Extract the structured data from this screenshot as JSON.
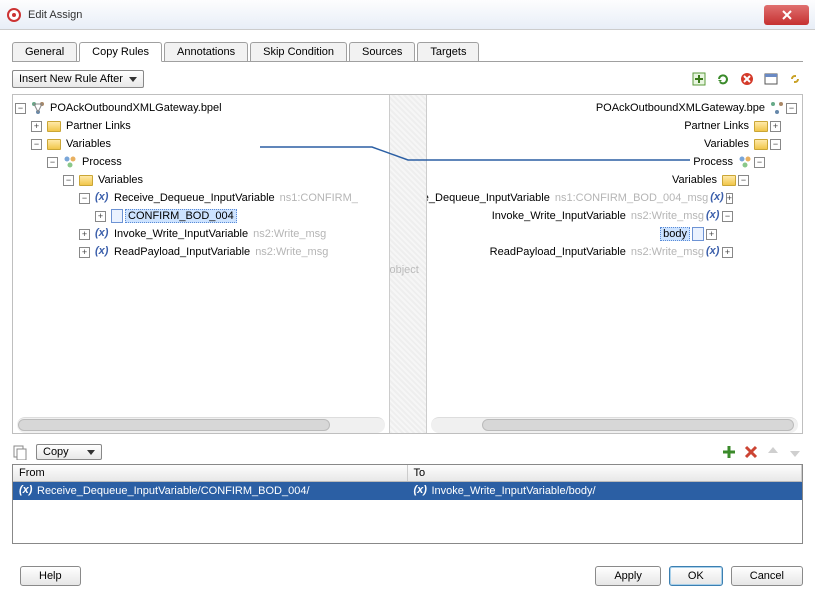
{
  "window": {
    "title": "Edit Assign"
  },
  "tabs": [
    "General",
    "Copy Rules",
    "Annotations",
    "Skip Condition",
    "Sources",
    "Targets"
  ],
  "active_tab": 1,
  "insert_label": "Insert New Rule After",
  "left_tree": {
    "root": "POAckOutboundXMLGateway.bpel",
    "partner_links": "Partner Links",
    "variables": "Variables",
    "process": "Process",
    "variables2": "Variables",
    "items": [
      {
        "name": "Receive_Dequeue_InputVariable",
        "ann": "ns1:CONFIRM_",
        "children": [
          {
            "name": "CONFIRM_BOD_004",
            "selected": true
          }
        ]
      },
      {
        "name": "Invoke_Write_InputVariable",
        "ann": "ns2:Write_msg"
      },
      {
        "name": "ReadPayload_InputVariable",
        "ann": "ns2:Write_msg"
      }
    ]
  },
  "right_tree": {
    "root": "POAckOutboundXMLGateway.bpe",
    "partner_links": "Partner Links",
    "variables": "Variables",
    "process": "Process",
    "variables2": "Variables",
    "items": [
      {
        "name": "Receive_Dequeue_InputVariable",
        "ann": "ns1:CONFIRM_BOD_004_msg"
      },
      {
        "name": "Invoke_Write_InputVariable",
        "ann": "ns2:Write_msg",
        "children": [
          {
            "name": "body",
            "selected": true
          }
        ]
      },
      {
        "name": "ReadPayload_InputVariable",
        "ann": "ns2:Write_msg"
      }
    ]
  },
  "mid_label": "object",
  "copy_label": "Copy",
  "table": {
    "headers": [
      "From",
      "To"
    ],
    "row": {
      "from": "Receive_Dequeue_InputVariable/CONFIRM_BOD_004/",
      "to": "Invoke_Write_InputVariable/body/"
    }
  },
  "footer": {
    "help": "Help",
    "apply": "Apply",
    "ok": "OK",
    "cancel": "Cancel"
  },
  "colors": {
    "selection": "#2b5fa4"
  }
}
